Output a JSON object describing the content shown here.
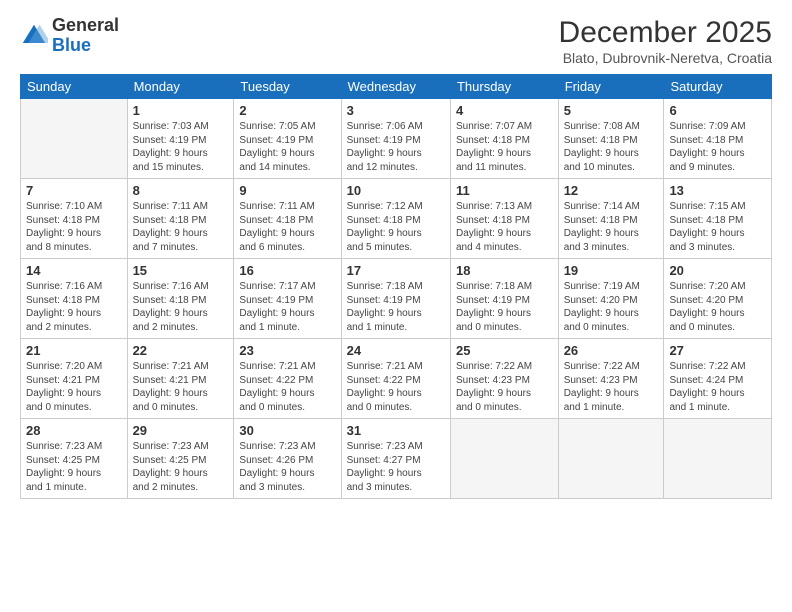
{
  "logo": {
    "general": "General",
    "blue": "Blue"
  },
  "header": {
    "month": "December 2025",
    "location": "Blato, Dubrovnik-Neretva, Croatia"
  },
  "days_of_week": [
    "Sunday",
    "Monday",
    "Tuesday",
    "Wednesday",
    "Thursday",
    "Friday",
    "Saturday"
  ],
  "weeks": [
    [
      {
        "day": "",
        "empty": true
      },
      {
        "day": "1",
        "sunrise": "7:03 AM",
        "sunset": "4:19 PM",
        "daylight": "9 hours and 15 minutes."
      },
      {
        "day": "2",
        "sunrise": "7:05 AM",
        "sunset": "4:19 PM",
        "daylight": "9 hours and 14 minutes."
      },
      {
        "day": "3",
        "sunrise": "7:06 AM",
        "sunset": "4:19 PM",
        "daylight": "9 hours and 12 minutes."
      },
      {
        "day": "4",
        "sunrise": "7:07 AM",
        "sunset": "4:18 PM",
        "daylight": "9 hours and 11 minutes."
      },
      {
        "day": "5",
        "sunrise": "7:08 AM",
        "sunset": "4:18 PM",
        "daylight": "9 hours and 10 minutes."
      },
      {
        "day": "6",
        "sunrise": "7:09 AM",
        "sunset": "4:18 PM",
        "daylight": "9 hours and 9 minutes."
      }
    ],
    [
      {
        "day": "7",
        "sunrise": "7:10 AM",
        "sunset": "4:18 PM",
        "daylight": "9 hours and 8 minutes."
      },
      {
        "day": "8",
        "sunrise": "7:11 AM",
        "sunset": "4:18 PM",
        "daylight": "9 hours and 7 minutes."
      },
      {
        "day": "9",
        "sunrise": "7:11 AM",
        "sunset": "4:18 PM",
        "daylight": "9 hours and 6 minutes."
      },
      {
        "day": "10",
        "sunrise": "7:12 AM",
        "sunset": "4:18 PM",
        "daylight": "9 hours and 5 minutes."
      },
      {
        "day": "11",
        "sunrise": "7:13 AM",
        "sunset": "4:18 PM",
        "daylight": "9 hours and 4 minutes."
      },
      {
        "day": "12",
        "sunrise": "7:14 AM",
        "sunset": "4:18 PM",
        "daylight": "9 hours and 3 minutes."
      },
      {
        "day": "13",
        "sunrise": "7:15 AM",
        "sunset": "4:18 PM",
        "daylight": "9 hours and 3 minutes."
      }
    ],
    [
      {
        "day": "14",
        "sunrise": "7:16 AM",
        "sunset": "4:18 PM",
        "daylight": "9 hours and 2 minutes."
      },
      {
        "day": "15",
        "sunrise": "7:16 AM",
        "sunset": "4:18 PM",
        "daylight": "9 hours and 2 minutes."
      },
      {
        "day": "16",
        "sunrise": "7:17 AM",
        "sunset": "4:19 PM",
        "daylight": "9 hours and 1 minute."
      },
      {
        "day": "17",
        "sunrise": "7:18 AM",
        "sunset": "4:19 PM",
        "daylight": "9 hours and 1 minute."
      },
      {
        "day": "18",
        "sunrise": "7:18 AM",
        "sunset": "4:19 PM",
        "daylight": "9 hours and 0 minutes."
      },
      {
        "day": "19",
        "sunrise": "7:19 AM",
        "sunset": "4:20 PM",
        "daylight": "9 hours and 0 minutes."
      },
      {
        "day": "20",
        "sunrise": "7:20 AM",
        "sunset": "4:20 PM",
        "daylight": "9 hours and 0 minutes."
      }
    ],
    [
      {
        "day": "21",
        "sunrise": "7:20 AM",
        "sunset": "4:21 PM",
        "daylight": "9 hours and 0 minutes."
      },
      {
        "day": "22",
        "sunrise": "7:21 AM",
        "sunset": "4:21 PM",
        "daylight": "9 hours and 0 minutes."
      },
      {
        "day": "23",
        "sunrise": "7:21 AM",
        "sunset": "4:22 PM",
        "daylight": "9 hours and 0 minutes."
      },
      {
        "day": "24",
        "sunrise": "7:21 AM",
        "sunset": "4:22 PM",
        "daylight": "9 hours and 0 minutes."
      },
      {
        "day": "25",
        "sunrise": "7:22 AM",
        "sunset": "4:23 PM",
        "daylight": "9 hours and 0 minutes."
      },
      {
        "day": "26",
        "sunrise": "7:22 AM",
        "sunset": "4:23 PM",
        "daylight": "9 hours and 1 minute."
      },
      {
        "day": "27",
        "sunrise": "7:22 AM",
        "sunset": "4:24 PM",
        "daylight": "9 hours and 1 minute."
      }
    ],
    [
      {
        "day": "28",
        "sunrise": "7:23 AM",
        "sunset": "4:25 PM",
        "daylight": "9 hours and 1 minute."
      },
      {
        "day": "29",
        "sunrise": "7:23 AM",
        "sunset": "4:25 PM",
        "daylight": "9 hours and 2 minutes."
      },
      {
        "day": "30",
        "sunrise": "7:23 AM",
        "sunset": "4:26 PM",
        "daylight": "9 hours and 3 minutes."
      },
      {
        "day": "31",
        "sunrise": "7:23 AM",
        "sunset": "4:27 PM",
        "daylight": "9 hours and 3 minutes."
      },
      {
        "day": "",
        "empty": true
      },
      {
        "day": "",
        "empty": true
      },
      {
        "day": "",
        "empty": true
      }
    ]
  ],
  "labels": {
    "sunrise": "Sunrise:",
    "sunset": "Sunset:",
    "daylight": "Daylight:"
  }
}
